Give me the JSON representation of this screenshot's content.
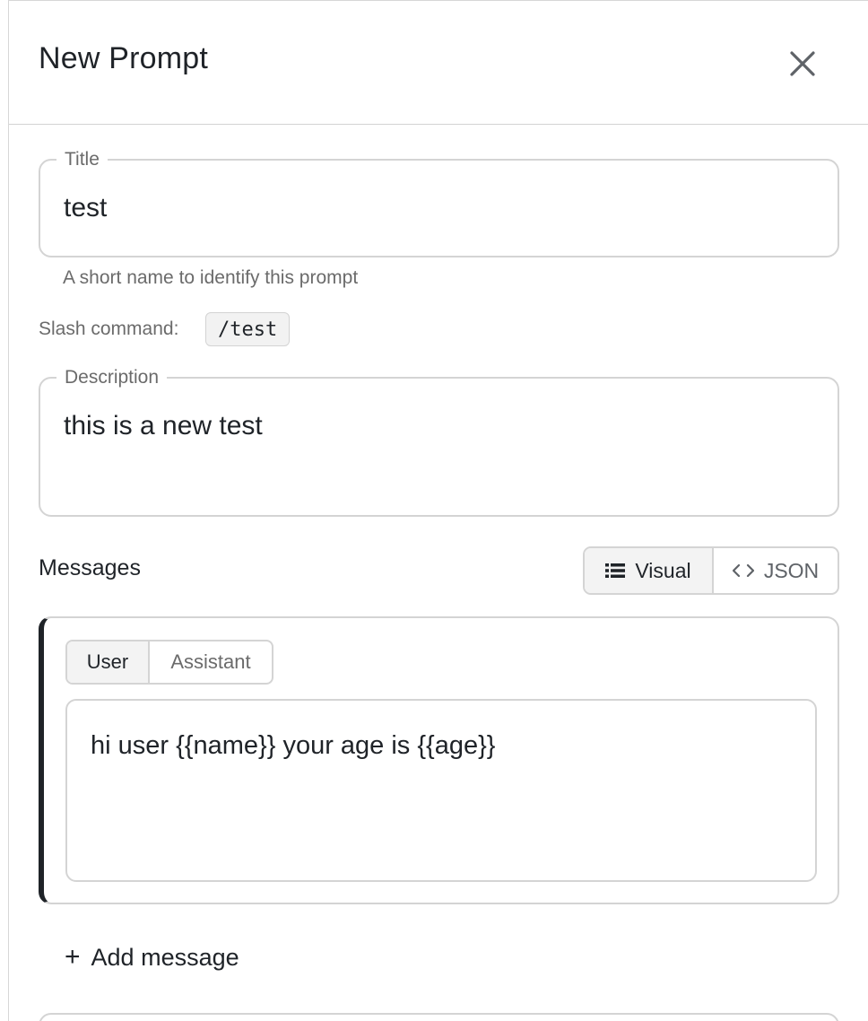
{
  "header": {
    "title": "New Prompt",
    "close_icon": "close-icon"
  },
  "title_field": {
    "legend": "Title",
    "value": "test",
    "helper": "A short name to identify this prompt"
  },
  "slash_command": {
    "label": "Slash command:",
    "value": "/test"
  },
  "description_field": {
    "legend": "Description",
    "value": "this is a new test"
  },
  "messages": {
    "heading": "Messages",
    "view_toggle": {
      "visual_label": "Visual",
      "json_label": "JSON",
      "selected": "Visual"
    },
    "items": [
      {
        "role_options": [
          "User",
          "Assistant"
        ],
        "selected_role": "User",
        "content": "hi user {{name}} your age is {{age}}"
      }
    ],
    "add_label": "Add message"
  },
  "colors": {
    "accent": "#1f2328",
    "border": "#d4d4d4",
    "muted": "#6b6b6b",
    "selected_bg": "#f3f3f3"
  }
}
